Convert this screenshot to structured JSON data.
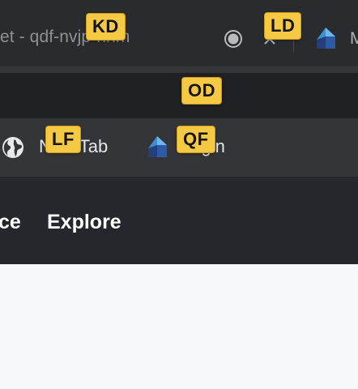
{
  "tabs": {
    "active_title": "et - qdf-nvjp-hhm",
    "next_title": "M"
  },
  "bookmarks": [
    {
      "label": "New Tab"
    },
    {
      "label": "Login"
    }
  ],
  "site_nav": {
    "items": [
      {
        "label": "ce"
      },
      {
        "label": "Explore"
      }
    ]
  },
  "hints": {
    "kd": "KD",
    "ld": "LD",
    "od": "OD",
    "lf": "LF",
    "qf": "QF"
  },
  "colors": {
    "hint_background": "#f6c945",
    "tab_strip": "#2a2b2e",
    "bookmarks_bar": "#343538",
    "site_nav": "#24272c",
    "page_background": "#f7f8fb"
  },
  "icons": {
    "record": "record-icon",
    "close_tab": "close-icon",
    "site_logo": "site-logo-icon",
    "globe": "globe-icon"
  }
}
